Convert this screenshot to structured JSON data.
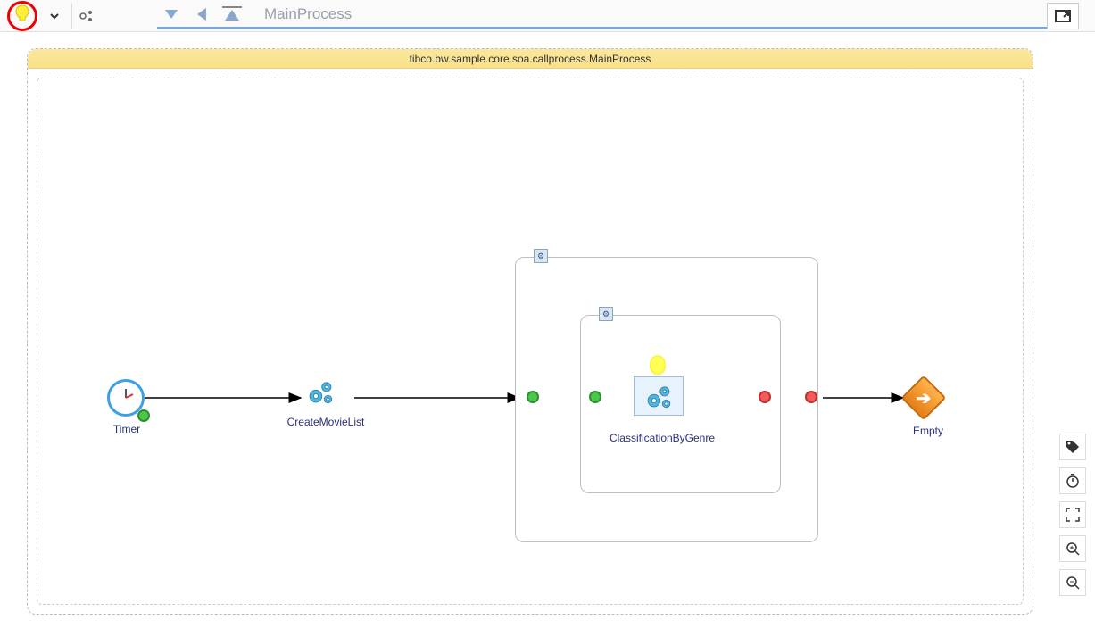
{
  "toolbar": {
    "highlight_icon": "bulb-icon",
    "dropdown_icon": "chevron-down-icon",
    "settings_icon": "settings-icon"
  },
  "breadcrumb": {
    "current": "MainProcess"
  },
  "process": {
    "title": "tibco.bw.sample.core.soa.callprocess.MainProcess",
    "nodes": {
      "timer": {
        "label": "Timer"
      },
      "createMovieList": {
        "label": "CreateMovieList"
      },
      "classification": {
        "label": "ClassificationByGenre"
      },
      "empty": {
        "label": "Empty"
      }
    }
  },
  "sidebar": {
    "tag": "tag-icon",
    "timer": "stopwatch-icon",
    "fit": "fit-to-screen-icon",
    "zoomIn": "zoom-in-icon",
    "zoomOut": "zoom-out-icon"
  }
}
